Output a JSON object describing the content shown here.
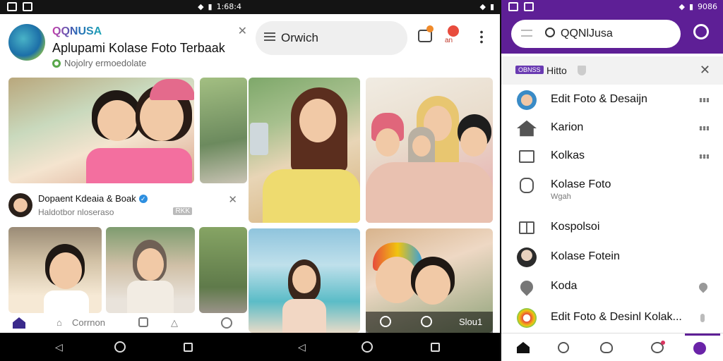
{
  "left_panel": {
    "status_bar": {
      "time": "1:68:4"
    },
    "brand": "QQNUSA",
    "title": "Aplupami Kolase Foto Terbaak",
    "subtitle": "Nojolry ermoedolate",
    "author": {
      "name": "Dopaent Kdeaia & Boak",
      "handle": "Haldotbor nloseraso",
      "badge": "RKK"
    },
    "tabs": [
      {
        "label": "Corrnon"
      }
    ]
  },
  "middle_panel": {
    "search": {
      "value": "Orwich"
    },
    "notification_label": "an",
    "overlay_label": "Slou1"
  },
  "right_panel": {
    "status_bar": {
      "time": "9086"
    },
    "search": {
      "value": "QQNlJusa"
    },
    "banner": {
      "tag": "OBNSS",
      "label": "Hitto"
    },
    "menu_items": [
      {
        "label": "Edit Foto & Desaijn",
        "icon": "photo-avatar-icon",
        "trailing": "dots"
      },
      {
        "label": "Karion",
        "icon": "home-icon",
        "trailing": "dots"
      },
      {
        "label": "Kolkas",
        "icon": "mail-icon",
        "trailing": "dots"
      },
      {
        "label": "Kolase Foto",
        "sub": "Wgah",
        "icon": "bag-icon"
      },
      {
        "label": "Kospolsoi",
        "icon": "book-icon"
      },
      {
        "label": "Kolase Fotein",
        "icon": "user-avatar-icon"
      },
      {
        "label": "Koda",
        "icon": "heart-icon",
        "trailing": "heart"
      },
      {
        "label": "Edit Foto & Desinl Kolak...",
        "icon": "color-icon",
        "trailing": "pin"
      }
    ]
  },
  "colors": {
    "accent_purple": "#5e1f96",
    "status_bar": "#141414",
    "verified_blue": "#2d8fe0"
  }
}
